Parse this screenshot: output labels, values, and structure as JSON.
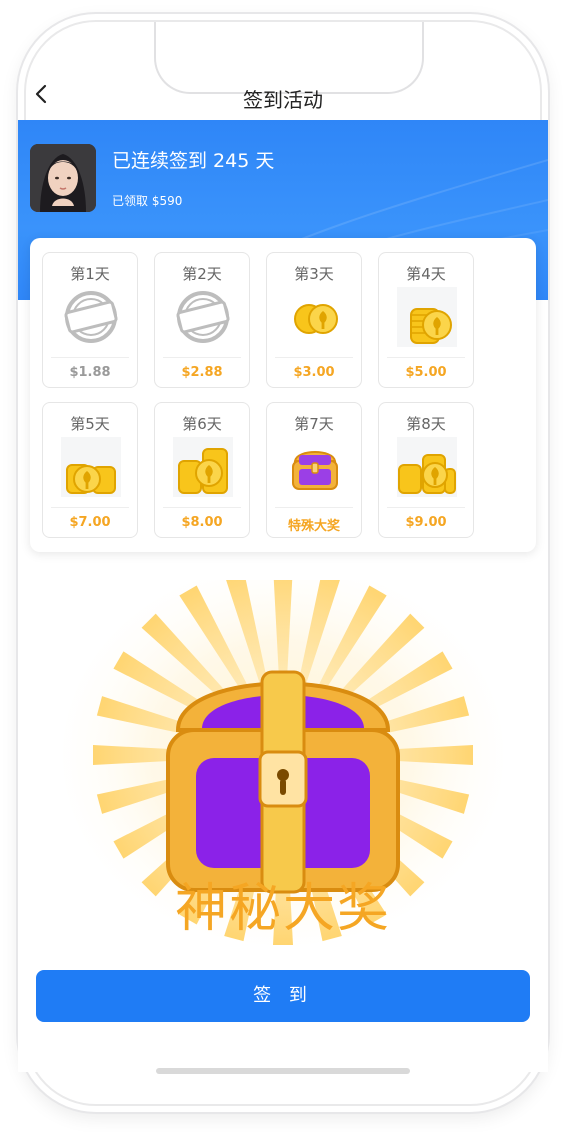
{
  "nav": {
    "back_icon": "chevron-left-icon",
    "title": "签到活动"
  },
  "user": {
    "streak_text": "已连续签到 245 天",
    "claimed_text": "已领取 $590"
  },
  "days": [
    {
      "label": "第1天",
      "value": "$1.88",
      "claimed": true,
      "stamp": "已领取",
      "icon": "claimed-stamp-icon"
    },
    {
      "label": "第2天",
      "value": "$2.88",
      "claimed": true,
      "stamp": "已领取",
      "icon": "claimed-stamp-icon"
    },
    {
      "label": "第3天",
      "value": "$3.00",
      "claimed": false,
      "icon": "two-coins-icon"
    },
    {
      "label": "第4天",
      "value": "$5.00",
      "claimed": false,
      "icon": "coin-stack-icon"
    },
    {
      "label": "第5天",
      "value": "$7.00",
      "claimed": false,
      "icon": "coin-stacks-icon"
    },
    {
      "label": "第6天",
      "value": "$8.00",
      "claimed": false,
      "icon": "coin-stacks-icon"
    },
    {
      "label": "第7天",
      "value": "特殊大奖",
      "claimed": false,
      "icon": "treasure-chest-icon"
    },
    {
      "label": "第8天",
      "value": "$9.00",
      "claimed": false,
      "icon": "coin-stacks-icon"
    }
  ],
  "prize": {
    "title": "神秘大奖",
    "icon": "treasure-chest-icon"
  },
  "button": {
    "label": "签 到"
  },
  "colors": {
    "blue": "#2f86f7",
    "button_blue": "#1f7cf5",
    "gold": "#f5a623",
    "purple": "#8a2be2"
  }
}
